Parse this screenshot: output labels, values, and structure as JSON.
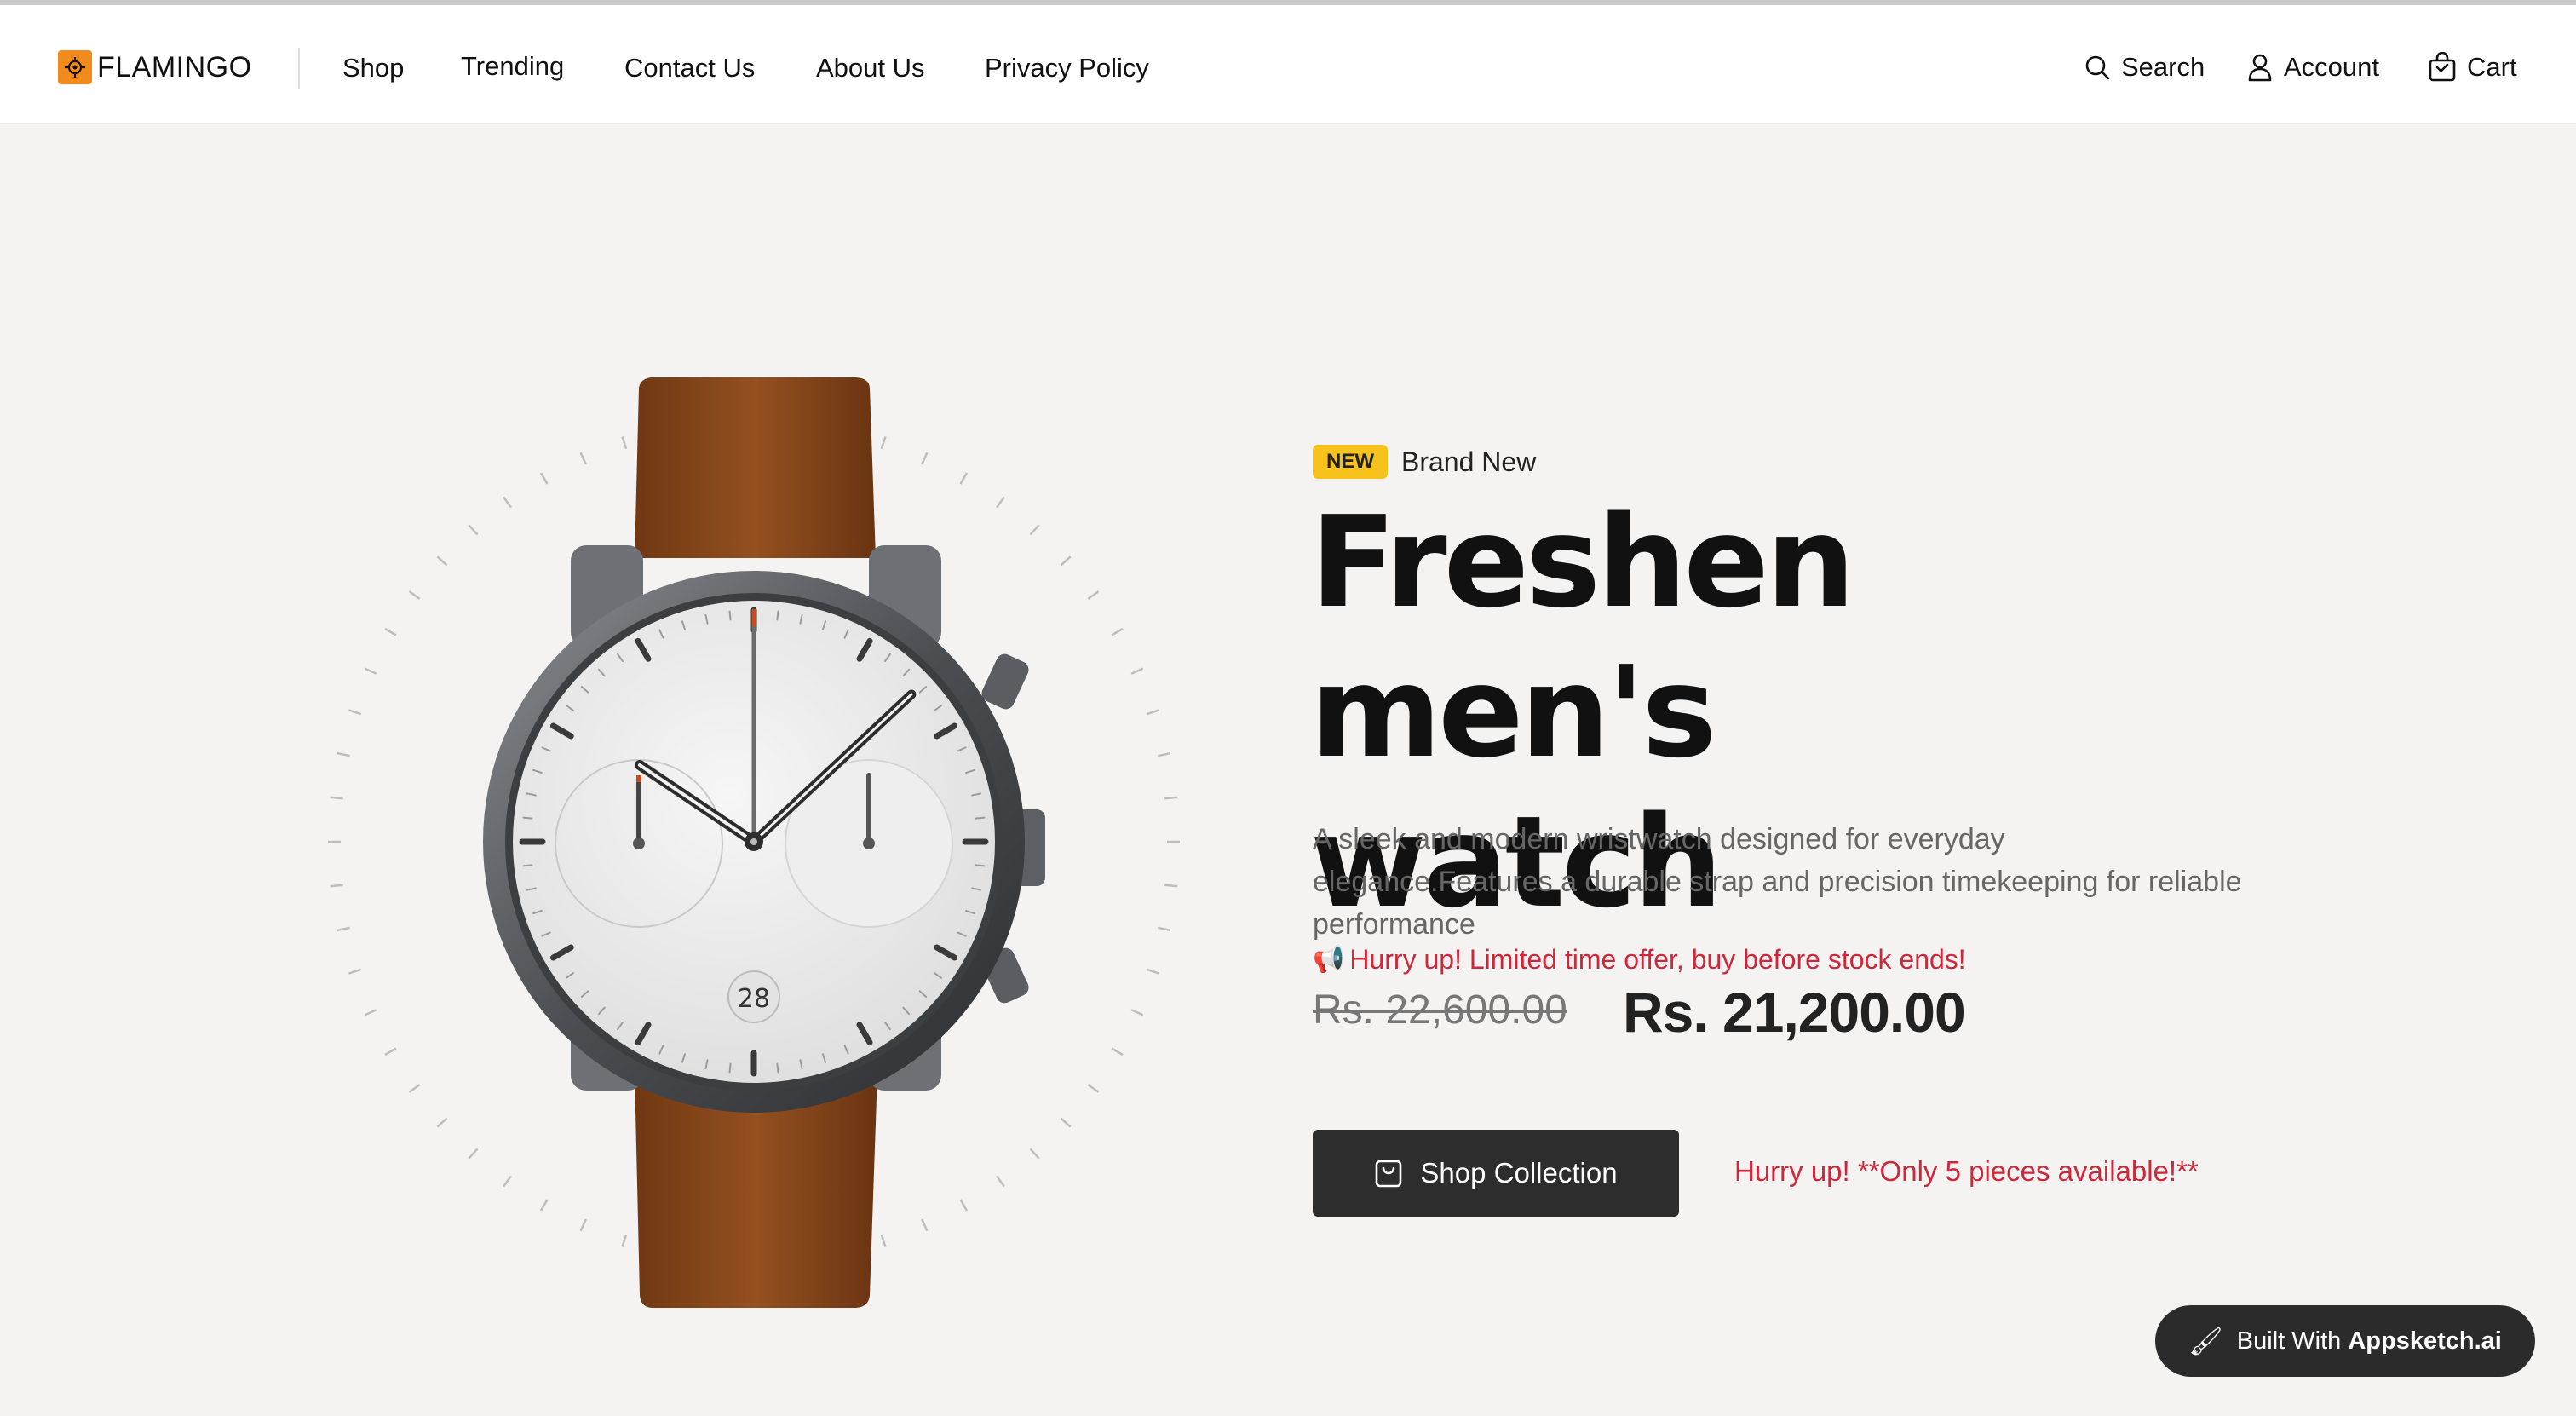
{
  "header": {
    "brand": "FLAMINGO",
    "nav": [
      "Shop",
      "Trending",
      "Contact Us",
      "About Us",
      "Privacy Policy"
    ],
    "search_label": "Search",
    "account_label": "Account",
    "cart_label": "Cart"
  },
  "hero": {
    "badge": "NEW",
    "badge_text": "Brand New",
    "title_line1": "Freshen men's",
    "title_line2": "watch",
    "description": "A sleek and modern wristwatch designed for everyday elegance.Features a durable strap and precision timekeeping for reliable performance",
    "offer_text": "Hurry up! Limited time offer, buy before stock ends!",
    "old_price": "Rs. 22,600.00",
    "new_price": "Rs. 21,200.00",
    "cta_label": "Shop Collection",
    "stock_text": "Hurry up! **Only 5 pieces available!**",
    "watch_date": "28"
  },
  "footer_badge": {
    "prefix": "Built With ",
    "brand": "Appsketch.ai"
  },
  "colors": {
    "accent_badge": "#f7c21b",
    "alert_red": "#d0263a",
    "button_dark": "#2d2d2d",
    "logo_orange": "#f28b1c",
    "strap_brown": "#8b4a1f"
  },
  "icons": {
    "search": "search-icon",
    "account": "user-icon",
    "cart": "shopping-bag-icon",
    "cta": "shopping-bag-icon",
    "offer": "megaphone-icon",
    "appsketch": "paintbrush-icon"
  }
}
